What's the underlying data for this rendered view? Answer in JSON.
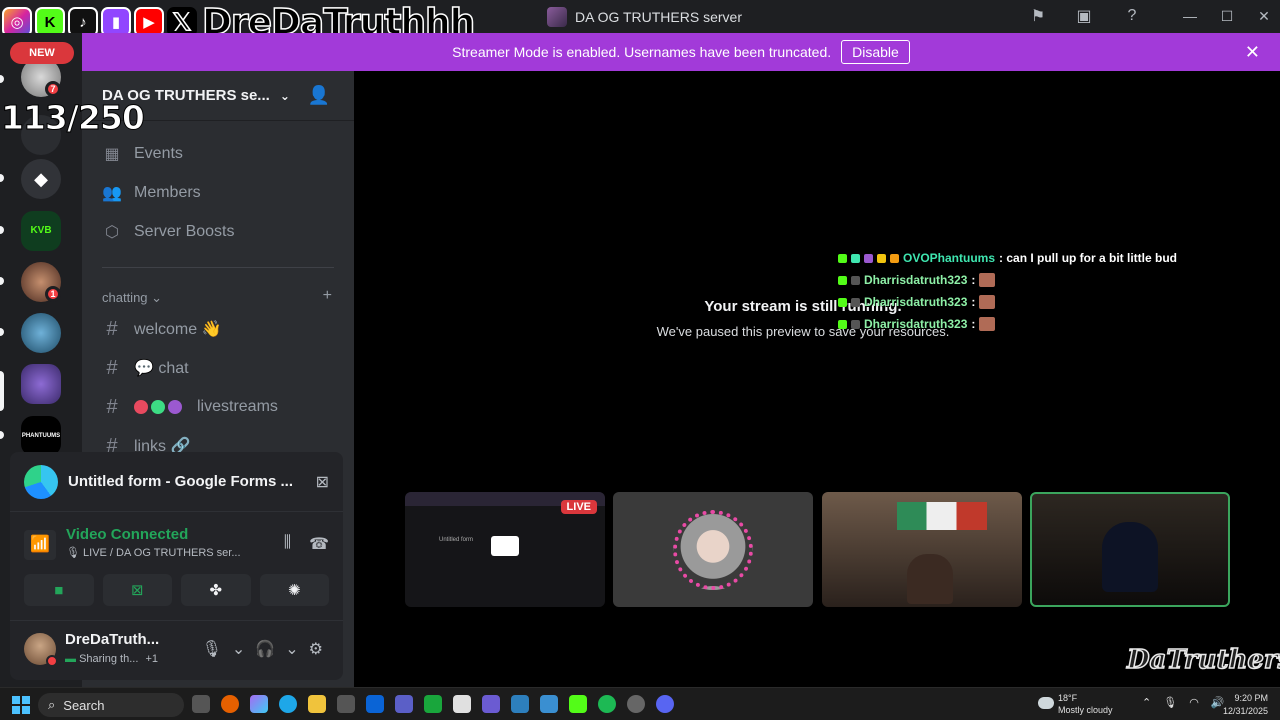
{
  "window": {
    "title": "DA OG TRUTHERS server"
  },
  "overlay": {
    "social_handle": "DreDaTruthhh",
    "counter": "113/250",
    "watermark": "DaTruthers"
  },
  "banner": {
    "text": "Streamer Mode is enabled. Usernames have been truncated.",
    "button": "Disable"
  },
  "rail": {
    "new_label": "NEW",
    "badges": [
      "7",
      "1"
    ],
    "server_labels": [
      "KVB",
      "PHANTUUMS"
    ]
  },
  "sidebar": {
    "server_name": "DA OG TRUTHERS se...",
    "nav": [
      {
        "label": "Events",
        "icon": "calendar-icon"
      },
      {
        "label": "Members",
        "icon": "members-icon"
      },
      {
        "label": "Server Boosts",
        "icon": "boost-icon"
      }
    ],
    "category": "chatting",
    "channels": [
      {
        "name": "welcome 👋"
      },
      {
        "name": "💬 chat"
      },
      {
        "name": "livestreams"
      },
      {
        "name": "links 🔗"
      }
    ]
  },
  "voice": {
    "stream_title": "Untitled form - Google Forms ...",
    "status": "Video Connected",
    "channel": "🎙 LIVE / DA OG TRUTHERS ser...",
    "user": {
      "name": "DreDaTruth...",
      "sub": "Sharing th...",
      "extra": "+1"
    }
  },
  "main": {
    "paused_title": "Your stream is still running.",
    "paused_sub": "We've paused this preview to save your resources.",
    "live_tag": "LIVE",
    "stream_preview_title": "Untitled form"
  },
  "chat_overlay": [
    {
      "name": "OVOPhantuums",
      "message": ": can I pull up for a bit little bud",
      "emote": false
    },
    {
      "name": "Dharrisdatruth323",
      "message": ":",
      "emote": true
    },
    {
      "name": "Dharrisdatruth323",
      "message": ":",
      "emote": true
    },
    {
      "name": "Dharrisdatruth323",
      "message": ":",
      "emote": true
    }
  ],
  "taskbar": {
    "search": "Search",
    "weather_temp": "18°F",
    "weather_desc": "Mostly cloudy",
    "time": "9:20 PM",
    "date": "12/31/2025"
  },
  "colors": {
    "banner": "#a23ad9",
    "connected": "#23a55a",
    "alert": "#da373c",
    "active_tile_border": "#3ba55d"
  }
}
